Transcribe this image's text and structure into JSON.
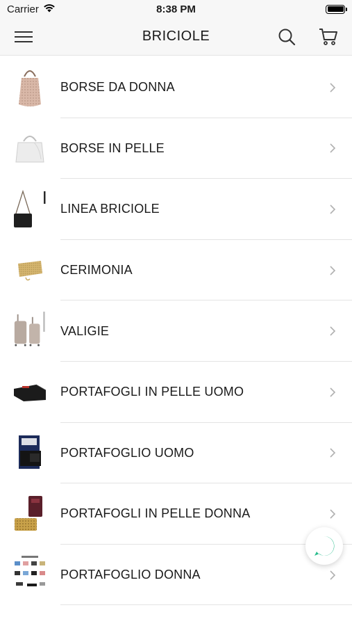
{
  "status_bar": {
    "carrier": "Carrier",
    "time": "8:38 PM"
  },
  "header": {
    "title": "BRICIOLE"
  },
  "categories": [
    {
      "label": "BORSE DA DONNA",
      "icon": "handbag-thumbnail"
    },
    {
      "label": "BORSE IN PELLE",
      "icon": "leather-bag-thumbnail"
    },
    {
      "label": "LINEA BRICIOLE",
      "icon": "crossbody-bag-thumbnail"
    },
    {
      "label": "CERIMONIA",
      "icon": "clutch-thumbnail"
    },
    {
      "label": "VALIGIE",
      "icon": "suitcase-thumbnail"
    },
    {
      "label": "PORTAFOGLI IN PELLE UOMO",
      "icon": "wallet-thumbnail"
    },
    {
      "label": "PORTAFOGLIO UOMO",
      "icon": "wallet-box-thumbnail"
    },
    {
      "label": "PORTAFOGLI IN PELLE DONNA",
      "icon": "women-wallet-thumbnail"
    },
    {
      "label": "PORTAFOGLIO DONNA",
      "icon": "wallet-collection-thumbnail"
    }
  ],
  "colors": {
    "chat_accent": "#2bbd8e",
    "bar_background": "#f7f7f7",
    "separator": "#e3e3e3"
  }
}
